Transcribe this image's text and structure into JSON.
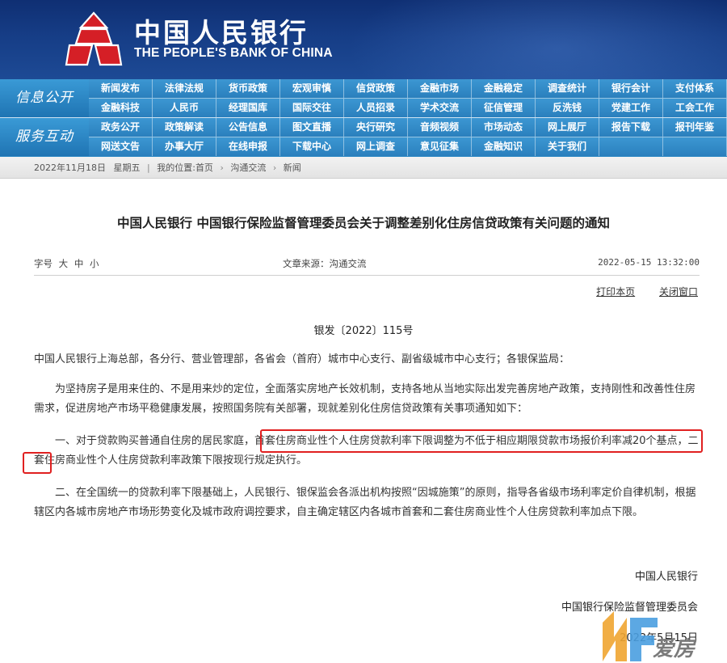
{
  "colors": {
    "header_bg": "#163d86",
    "nav_bg": "#2f8ac4",
    "highlight": "#e02020",
    "logo_red": "#d51f26"
  },
  "header": {
    "bank_name_cn": "中国人民银行",
    "bank_name_en": "THE PEOPLE'S BANK OF CHINA",
    "logo_icon": "pboc-emblem-icon"
  },
  "nav": {
    "sections": [
      {
        "label": "信息公开",
        "rows": [
          [
            "新闻发布",
            "法律法规",
            "货币政策",
            "宏观审慎",
            "信贷政策",
            "金融市场",
            "金融稳定",
            "调查统计",
            "银行会计",
            "支付体系"
          ],
          [
            "金融科技",
            "人民币",
            "经理国库",
            "国际交往",
            "人员招录",
            "学术交流",
            "征信管理",
            "反洗钱",
            "党建工作",
            "工会工作"
          ]
        ]
      },
      {
        "label": "服务互动",
        "rows": [
          [
            "政务公开",
            "政策解读",
            "公告信息",
            "图文直播",
            "央行研究",
            "音频视频",
            "市场动态",
            "网上展厅",
            "报告下载",
            "报刊年鉴"
          ],
          [
            "网送文告",
            "办事大厅",
            "在线申报",
            "下载中心",
            "网上调查",
            "意见征集",
            "金融知识",
            "关于我们",
            "",
            ""
          ]
        ]
      }
    ]
  },
  "breadcrumb": {
    "date": "2022年11月18日",
    "weekday": "星期五",
    "location_label": "我的位置:",
    "items": [
      "首页",
      "沟通交流",
      "新闻"
    ]
  },
  "article": {
    "title": "中国人民银行  中国银行保险监督管理委员会关于调整差别化住房信贷政策有关问题的通知",
    "font_size_label": "字号",
    "font_sizes": [
      "大",
      "中",
      "小"
    ],
    "source": "文章来源：沟通交流",
    "date": "2022-05-15  13:32:00",
    "print_label": "打印本页",
    "close_label": "关闭窗口",
    "doc_number": "银发〔2022〕115号",
    "addressee": "中国人民银行上海总部，各分行、营业管理部，各省会（首府）城市中心支行、副省级城市中心支行；各银保监局：",
    "p1": "为坚持房子是用来住的、不是用来炒的定位，全面落实房地产长效机制，支持各地从当地实际出发完善房地产政策，支持刚性和改善性住房需求，促进房地产市场平稳健康发展，按照国务院有关部署，现就差别化住房信贷政策有关事项通知如下：",
    "p2": "一、对于贷款购买普通自住房的居民家庭，首套住房商业性个人住房贷款利率下限调整为不低于相应期限贷款市场报价利率减20个基点，二套住房商业性个人住房贷款利率政策下限按现行规定执行。",
    "p3": "二、在全国统一的贷款利率下限基础上，人民银行、银保监会各派出机构按照“因城施策”的原则，指导各省级市场利率定价自律机制，根据辖区内各城市房地产市场形势变化及城市政府调控要求，自主确定辖区内各城市首套和二套住房商业性个人住房贷款利率加点下限。",
    "signatories": [
      "中国人民银行",
      "中国银行保险监督管理委员会",
      "2022年5月15日"
    ]
  },
  "watermark": {
    "text": "爱房",
    "icon": "nf-logo-icon"
  }
}
